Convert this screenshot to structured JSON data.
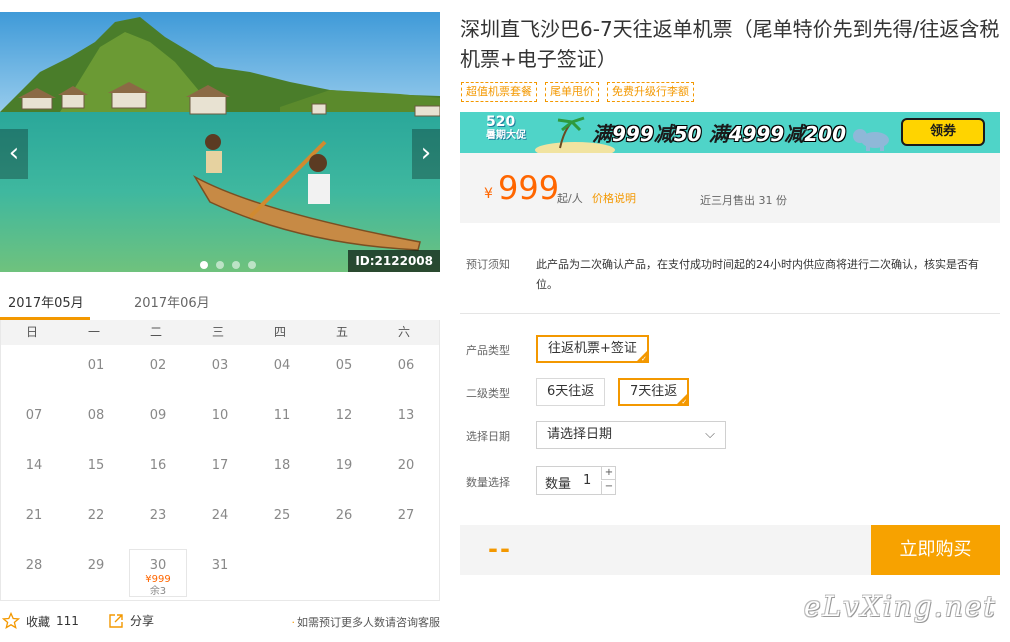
{
  "gallery": {
    "prev_icon": "‹",
    "next_icon": "›",
    "id_label": "ID:2122008",
    "dots": 4,
    "active_dot": 0
  },
  "calendar": {
    "tabs": [
      "2017年05月",
      "2017年06月"
    ],
    "active_tab": 0,
    "weekdays": [
      "日",
      "一",
      "二",
      "三",
      "四",
      "五",
      "六"
    ],
    "first_weekday_index": 1,
    "days": [
      "01",
      "02",
      "03",
      "04",
      "05",
      "06",
      "07",
      "08",
      "09",
      "10",
      "11",
      "12",
      "13",
      "14",
      "15",
      "16",
      "17",
      "18",
      "19",
      "20",
      "21",
      "22",
      "23",
      "24",
      "25",
      "26",
      "27",
      "28",
      "29",
      "30",
      "31"
    ],
    "available": [
      {
        "day": "30",
        "price": "¥999",
        "stock": "余3"
      }
    ]
  },
  "footer": {
    "favorite_label": "收藏",
    "favorite_count": "111",
    "share_label": "分享",
    "consult_text": "如需预订更多人数请咨询客服"
  },
  "product": {
    "title": "深圳直飞沙巴6-7天往返单机票（尾单特价先到先得/往返含税机票+电子签证）",
    "tags": [
      "超值机票套餐",
      "尾单甩价",
      "免费升级行李额"
    ]
  },
  "banner": {
    "logo_line1": "520",
    "logo_line2": "暑期大促",
    "text_a": "满",
    "text_b": "999",
    "text_c": "减",
    "text_d": "50",
    "text_e": "满",
    "text_f": "4999",
    "text_g": "减",
    "text_h": "200",
    "button": "领券"
  },
  "price": {
    "currency": "¥",
    "amount": "999",
    "unit": "起/人",
    "explain": "价格说明",
    "sold": "近三月售出 31 份"
  },
  "booking": {
    "notice_label": "预订须知",
    "notice_text": "此产品为二次确认产品，在支付成功时间起的24小时内供应商将进行二次确认，核实是否有位。",
    "product_type_label": "产品类型",
    "product_types": [
      "往返机票+签证"
    ],
    "product_type_selected": 0,
    "sub_type_label": "二级类型",
    "sub_types": [
      "6天往返",
      "7天往返"
    ],
    "sub_type_selected": 1,
    "date_label": "选择日期",
    "date_value": "请选择日期",
    "qty_label": "数量选择",
    "qty_field_label": "数量",
    "qty_value": "1",
    "qty_plus": "+",
    "qty_minus": "−"
  },
  "buy": {
    "total": "--",
    "button": "立即购买"
  },
  "watermark": "eLvXing.net",
  "colors": {
    "accent": "#f39800",
    "price": "#ff6600",
    "banner_bg": "#4fd4c8"
  }
}
